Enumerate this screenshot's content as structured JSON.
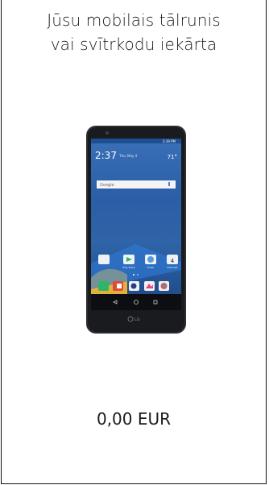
{
  "device": {
    "title_line1": "Jūsu mobilais tālrunis",
    "title_line2": "vai svītrkodu iekārta",
    "price": "0,00 EUR",
    "image": {
      "brand": "LG",
      "screen_time": "2:37",
      "screen_date": "Thu, May 4",
      "weather": "71°",
      "search_label": "Google",
      "apps": [
        "Play Store",
        "Email",
        "Calendar"
      ]
    }
  }
}
